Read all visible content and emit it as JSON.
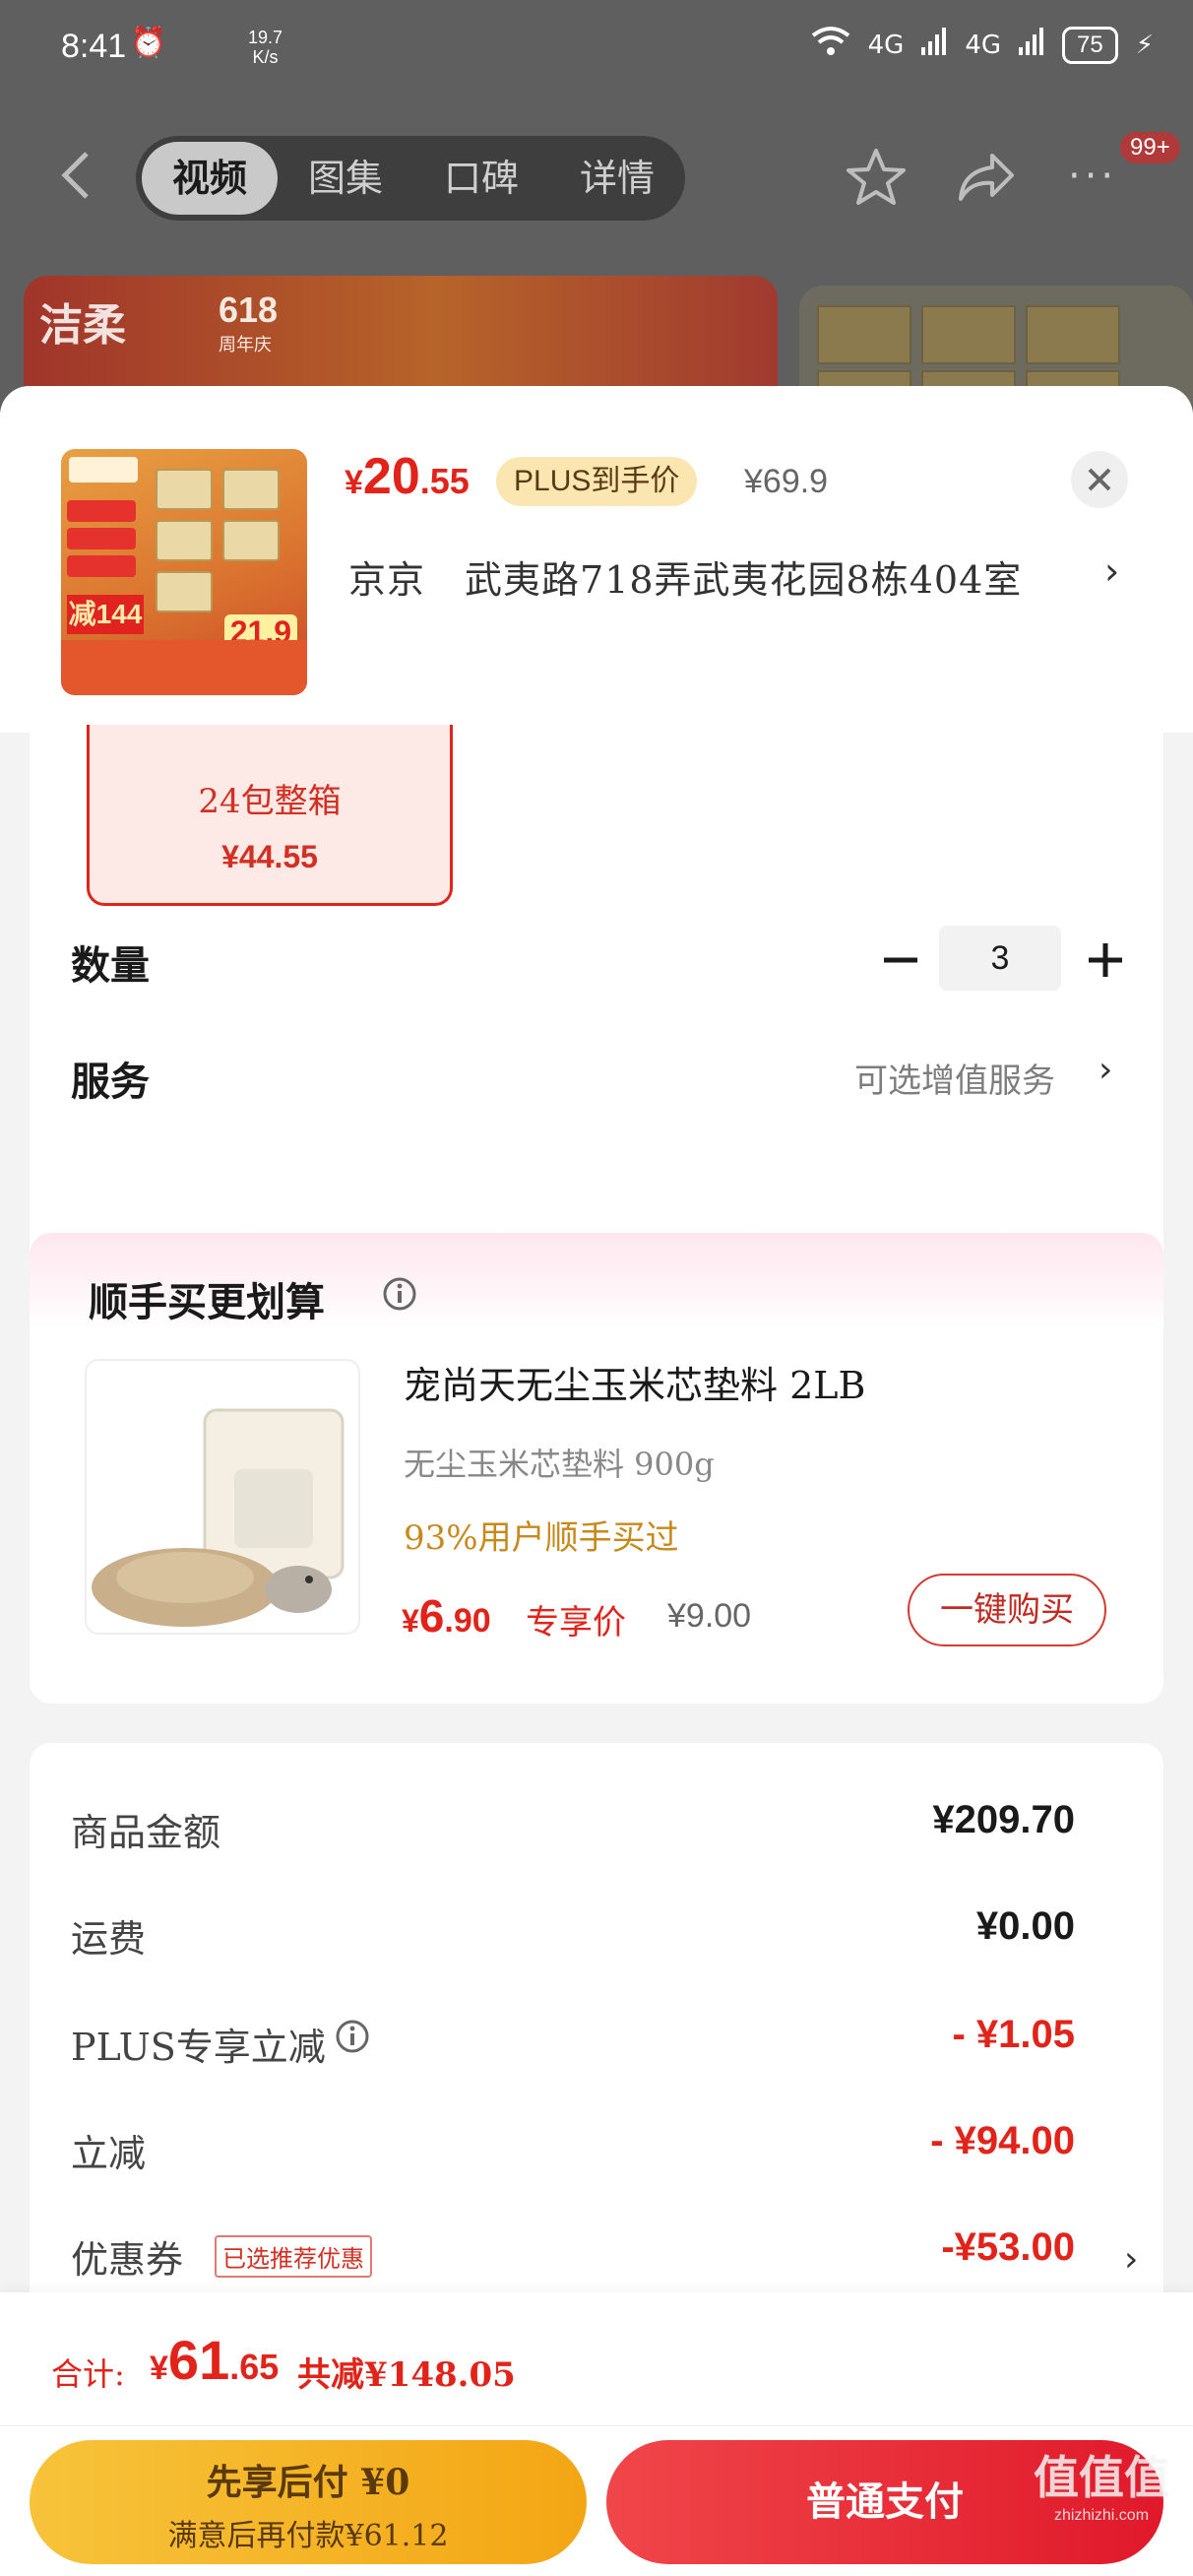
{
  "status_bar": {
    "time": "8:41",
    "net_speed_value": "19.7",
    "net_speed_unit": "K/s",
    "signal1": "4G",
    "signal2": "4G",
    "battery": "75"
  },
  "top_nav": {
    "tabs": [
      {
        "label": "视频",
        "active": true
      },
      {
        "label": "图集",
        "active": false
      },
      {
        "label": "口碑",
        "active": false
      },
      {
        "label": "详情",
        "active": false
      }
    ],
    "badge": "99+"
  },
  "banner": {
    "brand": "洁柔",
    "event_main": "618",
    "event_sub": "周年庆"
  },
  "sheet": {
    "price": {
      "currency": "¥",
      "integer": "20",
      "decimal": ".55"
    },
    "plus_badge": "PLUS到手价",
    "original_price": "¥69.9",
    "address": {
      "name": "京京",
      "detail": "武夷路718弄武夷花园8栋404室"
    },
    "thumb": {
      "big_text": "减144",
      "price": "21.9"
    }
  },
  "spec": {
    "variant": {
      "name": "24包整箱",
      "price": "¥44.55"
    },
    "quantity_label": "数量",
    "quantity_value": "3",
    "service_label": "服务",
    "service_link": "可选增值服务"
  },
  "addon": {
    "title": "顺手买更划算",
    "name": "宠尚天无尘玉米芯垫料 2LB",
    "sub": "无尘玉米芯垫料 900g",
    "percent_text": "93%用户顺手买过",
    "price": {
      "currency": "¥",
      "integer": "6",
      "decimal": ".90"
    },
    "exclusive": "专享价",
    "original_price": "¥9.00",
    "buy_button": "一键购买"
  },
  "summary": {
    "rows": [
      {
        "label": "商品金额",
        "value": "¥209.70"
      },
      {
        "label": "运费",
        "value": "¥0.00"
      },
      {
        "label": "PLUS专享立减",
        "value": "- ¥1.05"
      },
      {
        "label": "立减",
        "value": "- ¥94.00"
      },
      {
        "label": "优惠券",
        "value": "-¥53.00"
      }
    ],
    "coupon_tag": "已选推荐优惠"
  },
  "bottom": {
    "total_label": "合计:",
    "total": {
      "currency": "¥",
      "integer": "61",
      "decimal": ".65"
    },
    "saved": "共减¥148.05",
    "pay_later_line1": "先享后付 ¥0",
    "pay_later_line2": "满意后再付款¥61.12",
    "pay_button": "普通支付"
  },
  "watermark": {
    "main": "值值值",
    "sub": "zhizhizhi.com"
  },
  "colors": {
    "accent_red": "#e2231a",
    "pay_later_yellow": "#f7c33a",
    "pay_red": "#e0192a",
    "plus_gold": "#fbe6b2"
  }
}
